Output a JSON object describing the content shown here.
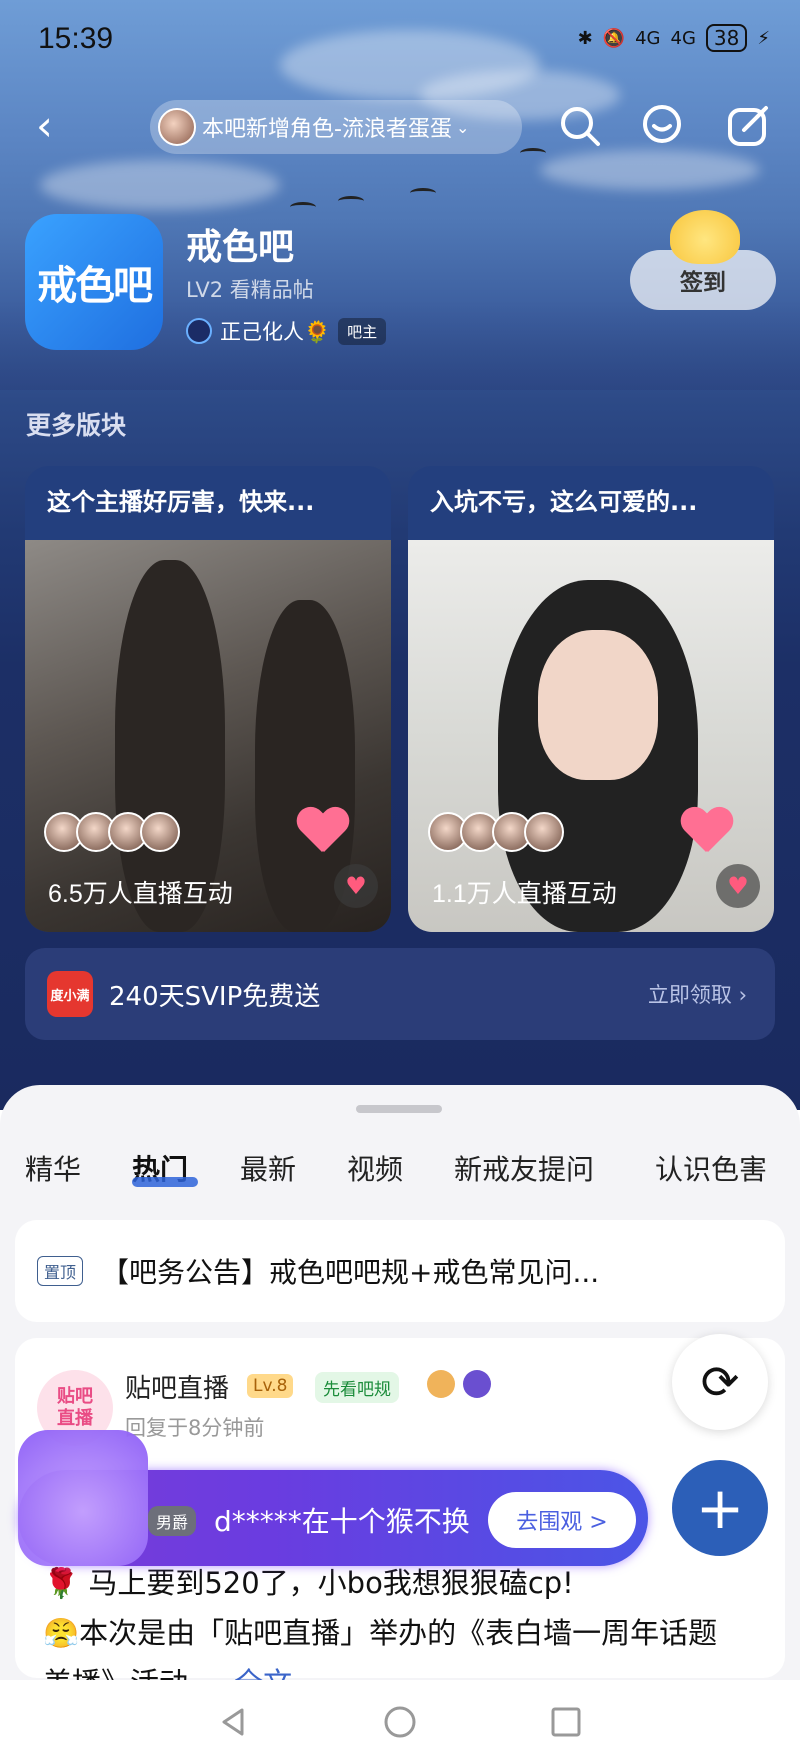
{
  "status_bar": {
    "time": "15:39",
    "signal_1": "4G",
    "signal_2": "4G",
    "battery": "38"
  },
  "top_nav": {
    "channel_pill": "本吧新增角色-流浪者蛋蛋"
  },
  "forum": {
    "name": "戒色吧",
    "logo_text": "戒色吧",
    "level_text": "LV2 看精品帖",
    "admin_name": "正己化人🌻",
    "admin_badge": "吧主",
    "sign_in_label": "签到"
  },
  "more_sections": {
    "title": "更多版块",
    "cards": [
      {
        "title": "这个主播好厉害，快来...",
        "count": "6.5万人直播互动"
      },
      {
        "title": "入坑不亏，这么可爱的...",
        "count": "1.1万人直播互动"
      }
    ]
  },
  "promo": {
    "logo_text": "度小满",
    "text": "240天SVIP免费送",
    "action": "立即领取 ›"
  },
  "tabs": [
    "精华",
    "热门",
    "最新",
    "视频",
    "新戒友提问",
    "认识色害"
  ],
  "active_tab": "热门",
  "notice": {
    "tag": "置顶",
    "text": "【吧务公告】戒色吧吧规+戒色常见问..."
  },
  "post": {
    "avatar_text": "贴吧\n直播",
    "author": "贴吧直播",
    "level": "Lv.8",
    "rule_badge": "先看吧规",
    "time": "回复于8分钟前",
    "line1": "🌹 马上要到520了，小bo我想狠狠磕cp!",
    "line2": "😤本次是由「贴吧直播」举办的《表白墙一周年话题",
    "line3_prefix": "美播》活动.....",
    "line3_more": "全文"
  },
  "banner": {
    "tag": "男爵",
    "text": "d*****在十个猴不换",
    "button": "去围观 >"
  },
  "colors": {
    "accent": "#2c5fb8",
    "hero_dark": "#1a2a5f",
    "sheet_bg": "#f4f4f7"
  },
  "icons": [
    "back-icon",
    "search-icon",
    "chat-icon",
    "edit-icon",
    "refresh-icon",
    "plus-icon",
    "nav-back-icon",
    "nav-home-icon",
    "nav-recents-icon"
  ]
}
